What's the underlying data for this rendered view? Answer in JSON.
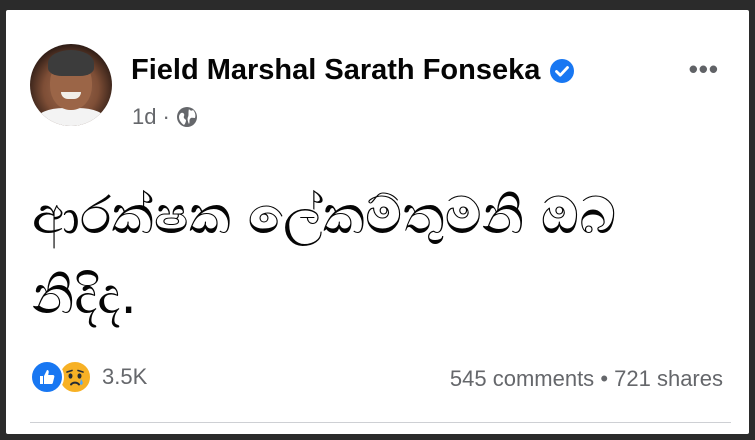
{
  "post": {
    "author": "Field Marshal Sarath Fonseka",
    "time": "1d",
    "separator": "·",
    "more_label": "•••",
    "text": "ආරක්ෂක ලේකම්තුමනි ඔබ නිදිද.",
    "reaction_count": "3.5K",
    "comments": "545 comments",
    "stats_separator": "•",
    "shares": "721 shares"
  },
  "icons": {
    "verified": "verified-badge-icon",
    "audience": "globe-icon",
    "more": "more-options-icon",
    "reactions": [
      "like-reaction-icon",
      "sad-reaction-icon"
    ]
  },
  "colors": {
    "verified": "#1877f2",
    "like": "#1877f2",
    "sad": "#f7b125",
    "secondary_text": "#65676b"
  }
}
